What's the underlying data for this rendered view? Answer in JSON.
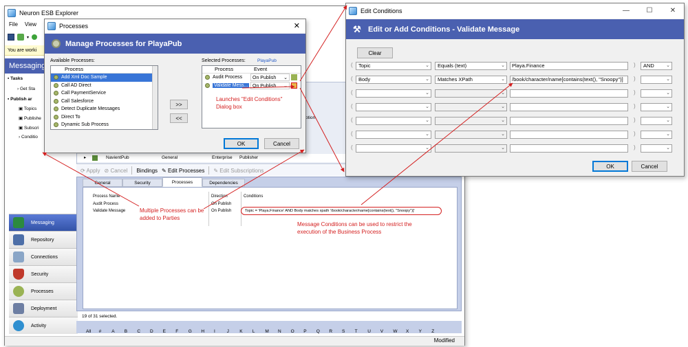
{
  "main": {
    "title": "Neuron ESB Explorer",
    "menu": [
      "File",
      "View"
    ],
    "info_bar": "You are worki",
    "section_header": "Messaging",
    "tree": {
      "tasks": "Tasks",
      "get_started": "Get Sta",
      "publish": "Publish ar",
      "items": [
        "Topics",
        "Publishe",
        "Subscri",
        "Conditio"
      ]
    },
    "nav": [
      "Messaging",
      "Repository",
      "Connections",
      "Security",
      "Processes",
      "Deployment",
      "Activity"
    ],
    "grid_option_header": "ption",
    "navientpub": {
      "name": "NavientPub",
      "type": "General",
      "cat": "Enterprise",
      "role": "Publisher"
    },
    "toolbar": {
      "apply": "Apply",
      "cancel": "Cancel",
      "bindings": "Bindings",
      "edit_processes": "Edit Processes",
      "edit_subscriptions": "Edit Subscriptions"
    },
    "tabs": [
      "General",
      "Security",
      "Processes",
      "Dependencies"
    ],
    "proc_table": {
      "headers": [
        "Process Name",
        "Direction",
        "Conditions"
      ],
      "rows": [
        {
          "name": "Audit Process",
          "direction": "On Publish",
          "conditions": ""
        },
        {
          "name": "Validate Message",
          "direction": "On Publish",
          "conditions": "Topic = 'Playa.Finance' AND Body matches xpath '/book/character/name[contains(text(), \"Snoopy\")]'"
        }
      ]
    },
    "selection_count": "19 of 31 selected.",
    "alphabet": [
      "All",
      "#",
      "A",
      "B",
      "C",
      "D",
      "E",
      "F",
      "G",
      "H",
      "I",
      "J",
      "K",
      "L",
      "M",
      "N",
      "O",
      "P",
      "Q",
      "R",
      "S",
      "T",
      "U",
      "V",
      "W",
      "X",
      "Y",
      "Z"
    ],
    "status": "Modified"
  },
  "processes_dialog": {
    "title": "Processes",
    "banner": "Manage Processes for PlayaPub",
    "available_label": "Available Processes:",
    "available_header": "Process",
    "available_items": [
      "Add Xml Doc Sample",
      "Call AD Direct",
      "Call PaymentService",
      "Call Salesforce",
      "Detect Duplicate Messages",
      "Direct To",
      "Dynamic Sub Process"
    ],
    "add_btn": ">>",
    "remove_btn": "<<",
    "selected_label": "Selected Processes:",
    "selected_party": "PlayaPub",
    "selected_headers": [
      "Process",
      "Event"
    ],
    "selected_items": [
      {
        "name": "Audit Process",
        "event": "On Publish"
      },
      {
        "name": "Validate Mess...",
        "event": "On Publish"
      }
    ],
    "ok": "OK",
    "cancel": "Cancel"
  },
  "edit_conditions": {
    "title": "Edit Conditions",
    "banner": "Edit or Add Conditions - Validate Message",
    "clear": "Clear",
    "rows": [
      {
        "field": "Topic",
        "op": "Equals (text)",
        "value": "Playa.Finance",
        "logic": "AND"
      },
      {
        "field": "Body",
        "op": "Matches XPath",
        "value": "/book/character/name[contains(text(), \"Snoopy\")]",
        "logic": ""
      },
      {
        "field": "",
        "op": "",
        "value": "",
        "logic": ""
      },
      {
        "field": "",
        "op": "",
        "value": "",
        "logic": ""
      },
      {
        "field": "",
        "op": "",
        "value": "",
        "logic": ""
      },
      {
        "field": "",
        "op": "",
        "value": "",
        "logic": ""
      },
      {
        "field": "",
        "op": "",
        "value": "",
        "logic": ""
      }
    ],
    "ok": "OK",
    "cancel": "Cancel",
    "caption_min": "—",
    "caption_max": "☐",
    "caption_close": "✕"
  },
  "annotations": {
    "launch": "Launches \"Edit Conditions\" Dialog box",
    "multiple": "Multiple Processes can be added to Parties",
    "conditions": "Message Conditions can be used to restrict the execution of the Business Process"
  },
  "colors": {
    "accent": "#4a60b0",
    "annotation": "#d42020",
    "selection": "#3875d7"
  }
}
